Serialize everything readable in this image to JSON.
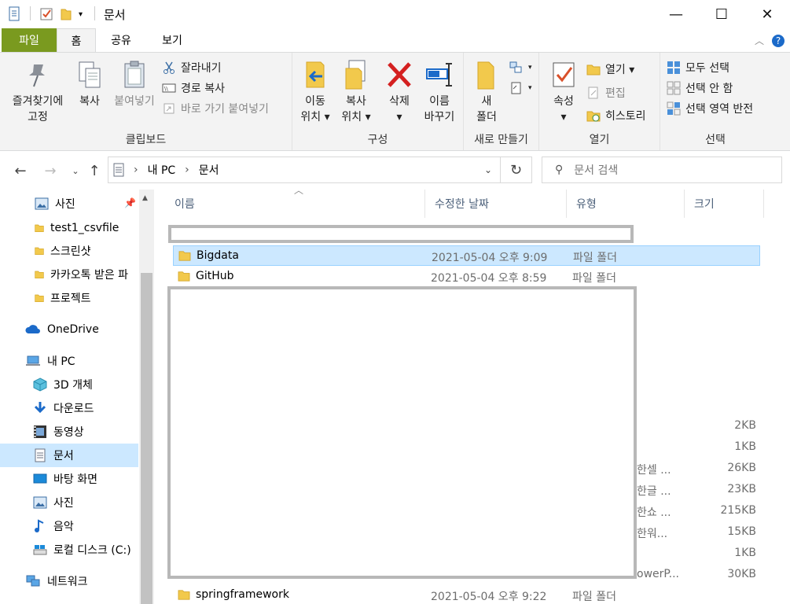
{
  "window": {
    "title": "문서",
    "minimize": "—",
    "maximize": "☐",
    "close": "✕"
  },
  "tabs": {
    "file": "파일",
    "home": "홈",
    "share": "공유",
    "view": "보기"
  },
  "ribbon": {
    "clipboard": {
      "label": "클립보드",
      "pin": [
        "즐겨찾기에",
        "고정"
      ],
      "copy": "복사",
      "paste": "붙여넣기",
      "cut": "잘라내기",
      "copy_path": "경로 복사",
      "paste_shortcut": "바로 가기 붙여넣기"
    },
    "organize": {
      "label": "구성",
      "move": [
        "이동",
        "위치 ▾"
      ],
      "copyto": [
        "복사",
        "위치 ▾"
      ],
      "delete": [
        "삭제",
        "▾"
      ],
      "rename": [
        "이름",
        "바꾸기"
      ]
    },
    "new": {
      "label": "새로 만들기",
      "folder": [
        "새",
        "폴더"
      ]
    },
    "open": {
      "label": "열기",
      "properties": [
        "속성",
        "▾"
      ],
      "open": "열기 ▾",
      "edit": "편집",
      "history": "히스토리"
    },
    "select": {
      "label": "선택",
      "all": "모두 선택",
      "none": "선택 안 함",
      "invert": "선택 영역 반전"
    }
  },
  "address": {
    "root": "내 PC",
    "sep": "›",
    "current": "문서",
    "search_placeholder": "문서 검색"
  },
  "navpane": {
    "items": [
      {
        "label": "사진",
        "icon": "pictures-icon"
      },
      {
        "label": "test1_csvfile",
        "icon": "folder-icon"
      },
      {
        "label": "스크린샷",
        "icon": "folder-icon"
      },
      {
        "label": "카카오톡 받은 파",
        "icon": "folder-icon"
      },
      {
        "label": "프로젝트",
        "icon": "folder-icon"
      },
      {
        "label": "OneDrive",
        "icon": "onedrive-icon"
      },
      {
        "label": "내 PC",
        "icon": "pc-icon"
      },
      {
        "label": "3D 개체",
        "icon": "3d-objects-icon"
      },
      {
        "label": "다운로드",
        "icon": "download-icon"
      },
      {
        "label": "동영상",
        "icon": "video-icon"
      },
      {
        "label": "문서",
        "icon": "documents-icon"
      },
      {
        "label": "바탕 화면",
        "icon": "desktop-icon"
      },
      {
        "label": "사진",
        "icon": "pictures-icon"
      },
      {
        "label": "음악",
        "icon": "music-icon"
      },
      {
        "label": "로컬 디스크 (C:)",
        "icon": "disk-icon"
      },
      {
        "label": "네트워크",
        "icon": "network-icon"
      }
    ]
  },
  "columns": {
    "name": "이름",
    "date": "수정한 날짜",
    "type": "유형",
    "size": "크기"
  },
  "files": [
    {
      "name": "Bigdata",
      "date": "2021-05-04 오후 9:09",
      "type": "파일 폴더",
      "size": ""
    },
    {
      "name": "GitHub",
      "date": "2021-05-04 오후 8:59",
      "type": "파일 폴더",
      "size": ""
    },
    {
      "name": "springframework",
      "date": "2021-05-04 오후 9:22",
      "type": "파일 폴더",
      "size": ""
    }
  ],
  "partial_rows": [
    {
      "type": "",
      "size": "2KB"
    },
    {
      "type": "",
      "size": "1KB"
    },
    {
      "type": "한셀 ...",
      "size": "26KB"
    },
    {
      "type": "한글 ...",
      "size": "23KB"
    },
    {
      "type": "한쇼 ...",
      "size": "215KB"
    },
    {
      "type": "한워...",
      "size": "15KB"
    },
    {
      "type": "",
      "size": "1KB"
    },
    {
      "type": "owerP...",
      "size": "30KB"
    }
  ],
  "colors": {
    "file_tab": "#7a9a1f",
    "selection": "#cce8ff",
    "folder": "#e8b730",
    "redaction": "#b8b8b8"
  }
}
